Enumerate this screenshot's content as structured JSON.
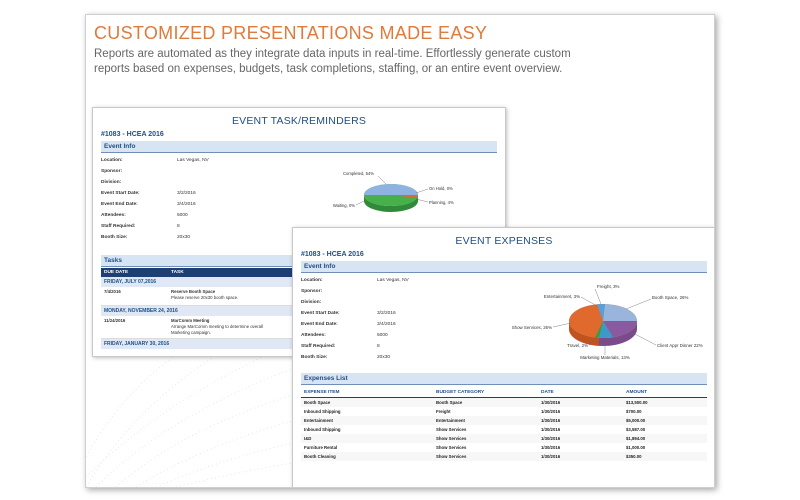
{
  "headline": "CUSTOMIZED PRESENTATIONS MADE EASY",
  "subtext_line1": "Reports are automated as they integrate data inputs in real-time. Effortlessly generate custom",
  "subtext_line2": "reports based on expenses, budgets, task completions, staffing, or an entire event overview.",
  "colors": {
    "headline": "#e07a3a",
    "report_blue": "#1e4f87",
    "section_bg": "#d6e4f3",
    "table_head": "#1e3f73"
  },
  "task_report": {
    "title": "EVENT TASK/REMINDERS",
    "event_id": "#1083 - HCEA 2016",
    "section_title": "Event Info",
    "info_rows": [
      {
        "label": "Location:",
        "value": "Las Vegas, NV"
      },
      {
        "label": "Sponsor:",
        "value": ""
      },
      {
        "label": "Division:",
        "value": ""
      },
      {
        "label": "Event Start Date:",
        "value": "3/2/2016"
      },
      {
        "label": "Event End Date:",
        "value": "3/4/2016"
      },
      {
        "label": "Attendees:",
        "value": "5000"
      },
      {
        "label": "Staff Required:",
        "value": "8"
      },
      {
        "label": "Booth Size:",
        "value": "20x30"
      }
    ],
    "pie_labels": {
      "completed": "Completed, 54%",
      "on_hold": "On Hold, 0%",
      "planning": "Planning, 4%",
      "waiting": "Waiting, 0%"
    },
    "tasks_title": "Tasks",
    "col_due_date": "DUE DATE",
    "col_task": "TASK",
    "day1": "FRIDAY, JULY 07,2016",
    "task1_date": "7/4/2016",
    "task1_name": "Reserve Booth Space",
    "task1_desc": "Please reserve 20x30 booth space.",
    "day2": "MONDAY, NOVEMBER 24, 2016",
    "task2_date": "11/24/2016",
    "task2_name": "MarComm Meeting",
    "task2_desc1": "Arrange MarComm meeting to determine overall",
    "task2_desc2": "Marketing campaign.",
    "day3": "FRIDAY, JANUARY 30, 2016"
  },
  "expense_report": {
    "title": "EVENT EXPENSES",
    "event_id": "#1083 - HCEA 2016",
    "section_title": "Event Info",
    "info_rows": [
      {
        "label": "Location:",
        "value": "Las Vegas, NV"
      },
      {
        "label": "Sponsor:",
        "value": ""
      },
      {
        "label": "Division:",
        "value": ""
      },
      {
        "label": "Event Start Date:",
        "value": "3/2/2016"
      },
      {
        "label": "Event End Date:",
        "value": "3/4/2016"
      },
      {
        "label": "Attendees:",
        "value": "5000"
      },
      {
        "label": "Staff Required:",
        "value": "8"
      },
      {
        "label": "Booth Size:",
        "value": "20x30"
      }
    ],
    "pie_labels": {
      "freight": "Freight, 3%",
      "entertainment": "Entertainment, 3%",
      "booth": "Booth Space, 26%",
      "show": "Show Services, 26%",
      "client": "Client Appr Dinner 22%",
      "travel": "Travel, 2%",
      "marketing": "Marketing Materials, 13%"
    },
    "list_title": "Expenses List",
    "columns": [
      "EXPENSE ITEM",
      "BUDGET CATEGORY",
      "DATE",
      "AMOUNT"
    ],
    "rows": [
      [
        "Booth Space",
        "Booth Space",
        "1/30/2016",
        "$13,500.00"
      ],
      [
        "Inbound Shipping",
        "Freight",
        "1/30/2016",
        "$700.00"
      ],
      [
        "Entertainment",
        "Entertainment",
        "1/30/2016",
        "$5,000.00"
      ],
      [
        "Inbound Shipping",
        "Show Services",
        "1/30/2016",
        "$3,587.00"
      ],
      [
        "I&D",
        "Show Services",
        "1/30/2016",
        "$1,894.00"
      ],
      [
        "Furniture Rental",
        "Show Services",
        "1/30/2016",
        "$1,000.00"
      ],
      [
        "Booth Cleaning",
        "Show Services",
        "1/30/2016",
        "$350.00"
      ]
    ]
  }
}
